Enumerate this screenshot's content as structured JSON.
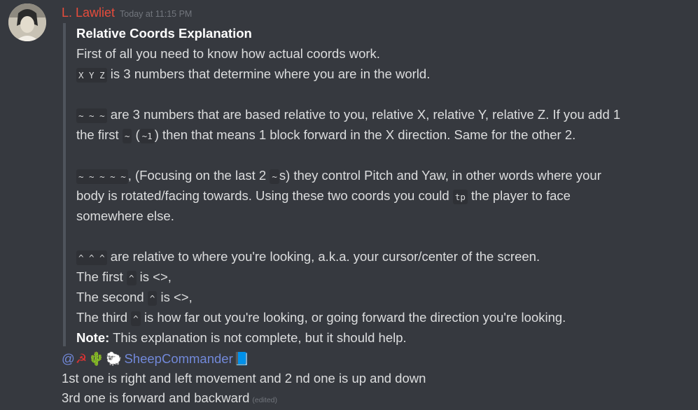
{
  "message": {
    "author": {
      "name": "L. Lawliet",
      "color": "#e74c3c"
    },
    "timestamp": "Today at 11:15 PM",
    "embed": {
      "title": "Relative Coords Explanation",
      "line1": "First of all you need to know how actual coords work.",
      "line2_code": "X Y Z",
      "line2_text": " is 3 numbers that determine where you are in the world.",
      "line3_code": "~ ~ ~",
      "line3_text": " are 3 numbers that are based relative to you, relative X, relative Y, relative Z. If you add 1",
      "line4_text_a": "the first ",
      "line4_code_a": "~",
      "line4_text_b": " (",
      "line4_code_b": "~1",
      "line4_text_c": ") then that means 1 block forward in the X direction. Same for the other 2.",
      "line5_code": "~ ~ ~ ~ ~",
      "line5_text_a": ", (Focusing on the last 2 ",
      "line5_code_b": "~",
      "line5_text_b": "s) they control Pitch and Yaw, in other words where your",
      "line6_text_a": "body is rotated/facing towards. Using these two coords you could ",
      "line6_code": "tp",
      "line6_text_b": " the player to face",
      "line7": "somewhere else.",
      "line8_code": "^ ^ ^",
      "line8_text": " are relative to where you're looking, a.k.a. your cursor/center of the screen.",
      "line9_a": "The first ",
      "line9_code": "^",
      "line9_b": " is <>,",
      "line10_a": "The second ",
      "line10_code": "^",
      "line10_b": " is <>,",
      "line11_a": "The third ",
      "line11_code": "^",
      "line11_b": " is how far out you're looking, or going forward the direction you're looking.",
      "note_label": "Note:",
      "note_text": " This explanation is not complete, but it should help."
    },
    "mention": {
      "at": "@",
      "emojis": [
        "☭",
        "🌵",
        "🐑"
      ],
      "name": "SheepCommander",
      "trailing_emoji": "📘",
      "color": "#7289da"
    },
    "reply_line1": "1st one is right and left movement and 2 nd one is up and down",
    "reply_line2": "3rd one is forward and backward",
    "edited_label": "(edited)"
  }
}
